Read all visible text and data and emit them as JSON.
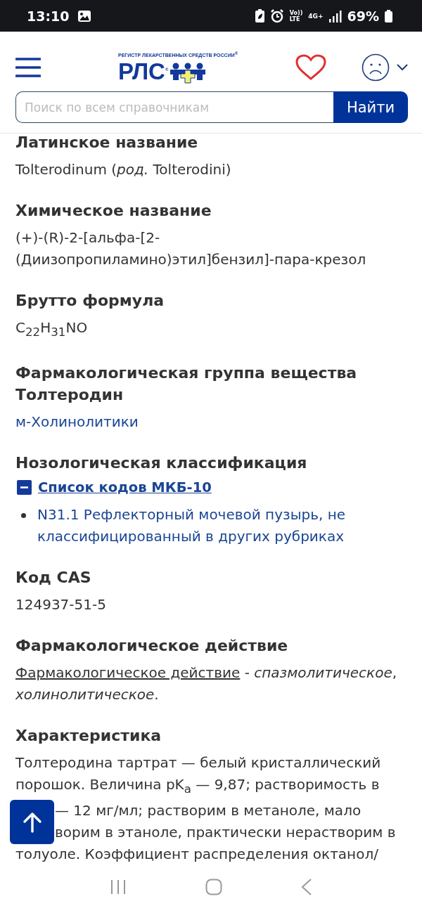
{
  "status_bar": {
    "time": "13:10",
    "battery": "69%",
    "network": "4G+",
    "volte_top": "Vo))",
    "volte_bottom": "LTE"
  },
  "header": {
    "logo_tagline": "РЕГИСТР ЛЕКАРСТВЕННЫХ СРЕДСТВ РОССИИ",
    "logo_text": "РЛС",
    "registered_mark": "®"
  },
  "search": {
    "placeholder": "Поиск по всем справочникам",
    "button": "Найти"
  },
  "sections": [
    {
      "kind": "text",
      "title": "Латинское название",
      "text": "Tolterodinum (*род.* Tolterodini)"
    },
    {
      "kind": "text",
      "title": "Химическое название",
      "text": "(+)-(R)-2-[альфа-[2-(Диизопропиламино)этил]бензил]-пара-крезол"
    },
    {
      "kind": "text",
      "title": "Брутто формула",
      "text": "C$_{22}$H$_{31}$NO"
    },
    {
      "kind": "link",
      "title": "Фармакологическая группа вещества Толтеродин",
      "link": "м-Холинолитики"
    },
    {
      "kind": "icd",
      "title": "Нозологическая классификация",
      "toggle": "Список кодов МКБ-10",
      "expanded": true,
      "items": [
        "N31.1 Рефлекторный мочевой пузырь, не классифицированный в других рубриках"
      ]
    },
    {
      "kind": "text",
      "title": "Код CAS",
      "text": "124937-51-5"
    },
    {
      "kind": "action",
      "title": "Фармакологическое действие",
      "link": "Фармакологическое действие",
      "text": " - *спазмолитическое*, *холинолитическое*."
    },
    {
      "kind": "lines",
      "title": "Характеристика",
      "lines": [
        {
          "text": "Толтеродина тартрат — белый кристаллический",
          "covered": false
        },
        {
          "text": "порошок. Величина pK$_{a}$ — 9,87; растворимость в",
          "covered": false
        },
        {
          "text": "— 12 мг/мл; растворим в метаноле, мало",
          "covered": true
        },
        {
          "text": "ворим в этаноле, практически нерастворим в",
          "covered": true
        },
        {
          "text": "толуоле. Коэффициент распределения октанол/",
          "covered": false
        }
      ]
    }
  ]
}
